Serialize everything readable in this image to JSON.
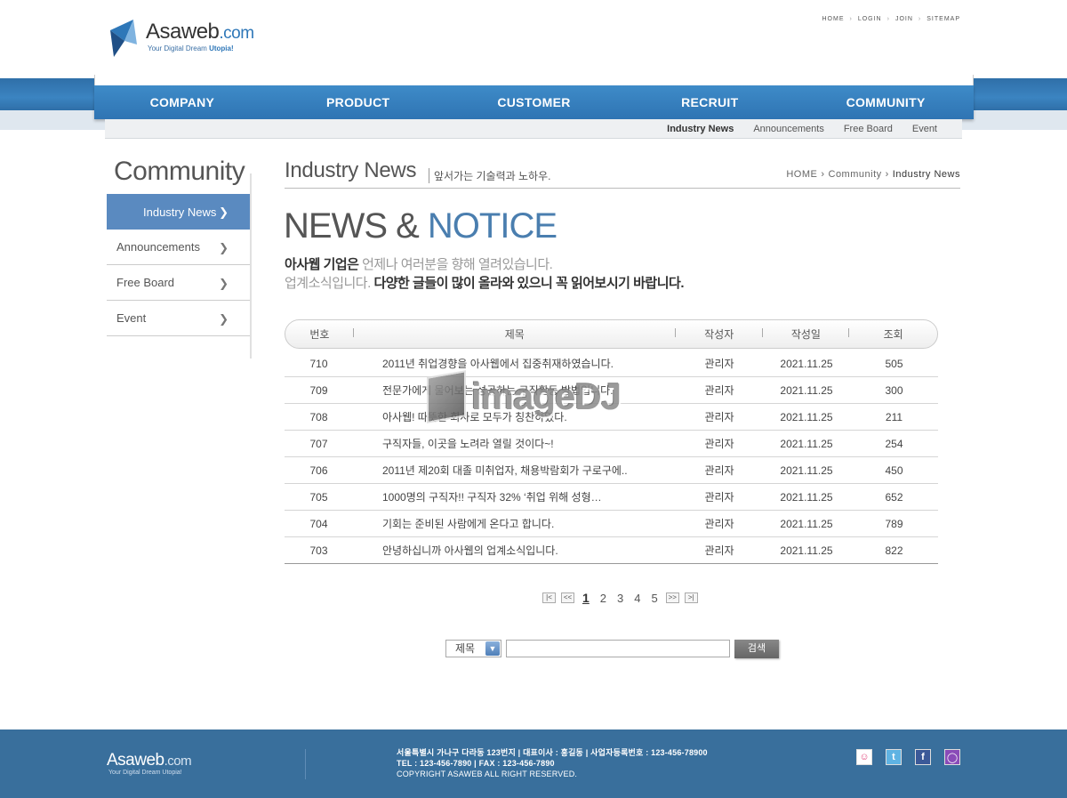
{
  "header": {
    "logo_name": "Asaweb",
    "logo_dot": ".com",
    "logo_tag_prefix": "Your Digital Dream ",
    "logo_tag_bold": "Utopia!",
    "util": [
      "HOME",
      "LOGIN",
      "JOIN",
      "SITEMAP"
    ]
  },
  "nav": {
    "items": [
      "COMPANY",
      "PRODUCT",
      "CUSTOMER",
      "RECRUIT",
      "COMMUNITY"
    ]
  },
  "subnav": {
    "items": [
      "Industry News",
      "Announcements",
      "Free Board",
      "Event"
    ]
  },
  "sidebar": {
    "title": "Community",
    "items": [
      "Industry News",
      "Announcements",
      "Free Board",
      "Event"
    ]
  },
  "content": {
    "title": "Industry News",
    "subtitle": "앞서가는 기술력과 노하우.",
    "breadcrumb": [
      "HOME",
      "Community",
      "Industry News"
    ],
    "headline_dark": "NEWS & ",
    "headline_blue": "NOTICE",
    "intro1_bold": "아사웹 기업은",
    "intro1_lite": " 언제나 여러분을 향해 열려있습니다.",
    "intro2_lite": "업계소식입니다.",
    "intro2_bold": " 다양한 글들이 많이 올라와 있으니 꼭 읽어보시기 바랍니다."
  },
  "table": {
    "headers": [
      "번호",
      "제목",
      "작성자",
      "작성일",
      "조회"
    ],
    "rows": [
      {
        "no": "710",
        "title": "2011년 취업경향을 아사웹에서 집중취재하였습니다.",
        "author": "관리자",
        "date": "2021.11.25",
        "views": "505"
      },
      {
        "no": "709",
        "title": "전문가에게 물어보는 성공하는 구직활동 방법입니다.",
        "author": "관리자",
        "date": "2021.11.25",
        "views": "300"
      },
      {
        "no": "708",
        "title": "아사웹! 따뜻한 회사로 모두가 칭찬하였다.",
        "author": "관리자",
        "date": "2021.11.25",
        "views": "211"
      },
      {
        "no": "707",
        "title": "구직자들, 이곳을 노려라 열릴 것이다~!",
        "author": "관리자",
        "date": "2021.11.25",
        "views": "254"
      },
      {
        "no": "706",
        "title": "2011년 제20회 대졸 미취업자, 채용박람회가 구로구에..",
        "author": "관리자",
        "date": "2021.11.25",
        "views": "450"
      },
      {
        "no": "705",
        "title": "1000명의 구직자!! 구직자 32% ‘취업 위해 성형…",
        "author": "관리자",
        "date": "2021.11.25",
        "views": "652"
      },
      {
        "no": "704",
        "title": "기회는 준비된 사람에게 온다고 합니다.",
        "author": "관리자",
        "date": "2021.11.25",
        "views": "789"
      },
      {
        "no": "703",
        "title": "안녕하십니까 아사웹의 업계소식입니다.",
        "author": "관리자",
        "date": "2021.11.25",
        "views": "822"
      }
    ]
  },
  "watermark": "imageDJ",
  "pager": {
    "pages": [
      "1",
      "2",
      "3",
      "4",
      "5"
    ],
    "current": "1",
    "first": "|<",
    "prev": "<<",
    "next": ">>",
    "last": ">|"
  },
  "search": {
    "select_value": "제목",
    "input_value": "",
    "button_label": "검색"
  },
  "footer": {
    "logo_name": "Asaweb",
    "logo_dot": ".com",
    "logo_tag": "Your Digital Dream Utopia!",
    "line1": "서울특별시 가나구 다라동 123번지  |  대표이사 : 홍길동  |  사업자등록번호 : 123-456-78900",
    "line2": "TEL : 123-456-7890  |  FAX : 123-456-7890",
    "line3": "COPYRIGHT ASAWEB ALL RIGHT RESERVED.",
    "icons": [
      "me2day-icon",
      "twitter-icon",
      "facebook-icon",
      "yozm-icon"
    ]
  },
  "colors": {
    "accent": "#4a7eaf",
    "nav_blue": "#3b84c1",
    "footer_bg": "#396f9c",
    "active_menu": "#5a8ac0"
  }
}
